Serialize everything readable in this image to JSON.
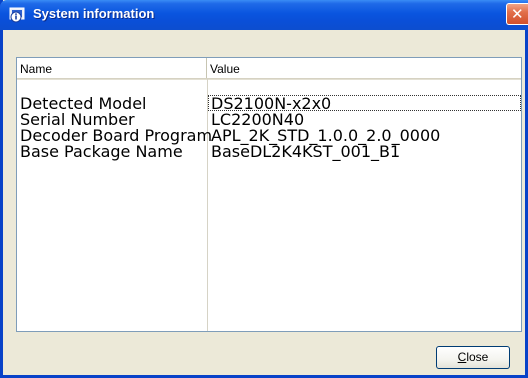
{
  "window": {
    "title": "System information",
    "close_glyph": "✕",
    "title_icon": "system-info-icon"
  },
  "list": {
    "columns": [
      "Name",
      "Value"
    ],
    "rows": [
      {
        "name": "Detected Model",
        "value": "DS2100N-x2x0"
      },
      {
        "name": "Serial Number",
        "value": "LC2200N40"
      },
      {
        "name": "Decoder Board Program",
        "value": "APL_2K_STD_1.0.0_2.0_0000"
      },
      {
        "name": "Base Package Name",
        "value": "BaseDL2K4KST_001_B1"
      }
    ]
  },
  "buttons": {
    "close_label": "Close"
  },
  "colors": {
    "titlebar": "#0a55df",
    "frame": "#0842c8",
    "dialog_bg": "#ece9d8",
    "close_button": "#d2502c"
  }
}
